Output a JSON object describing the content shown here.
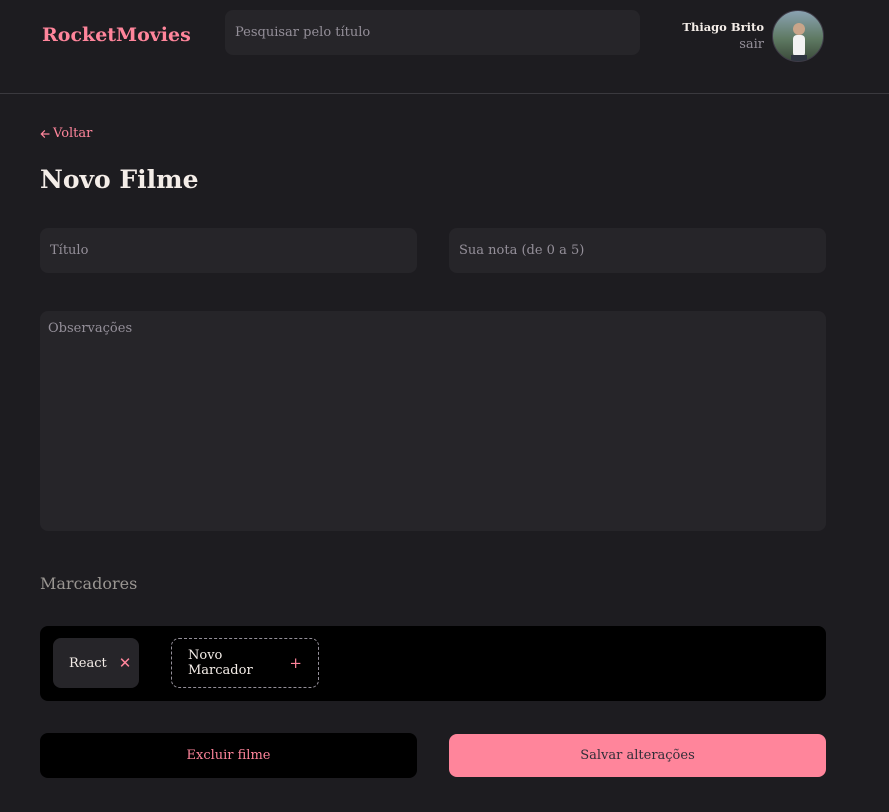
{
  "header": {
    "brand": "RocketMovies",
    "search_placeholder": "Pesquisar pelo título",
    "user_name": "Thiago Brito",
    "logout_label": "sair"
  },
  "nav": {
    "back_label": "Voltar"
  },
  "form": {
    "title": "Novo Filme",
    "title_placeholder": "Título",
    "rating_placeholder": "Sua nota (de 0 a 5)",
    "notes_placeholder": "Observações",
    "tags_section_title": "Marcadores",
    "tags": [
      {
        "label": "React"
      }
    ],
    "new_tag_placeholder": "Novo Marcador",
    "delete_label": "Excluir filme",
    "save_label": "Salvar alterações"
  },
  "colors": {
    "accent": "#ff859b",
    "background": "#1d1c20",
    "input_bg": "#262529",
    "dark_bg": "#000000"
  }
}
